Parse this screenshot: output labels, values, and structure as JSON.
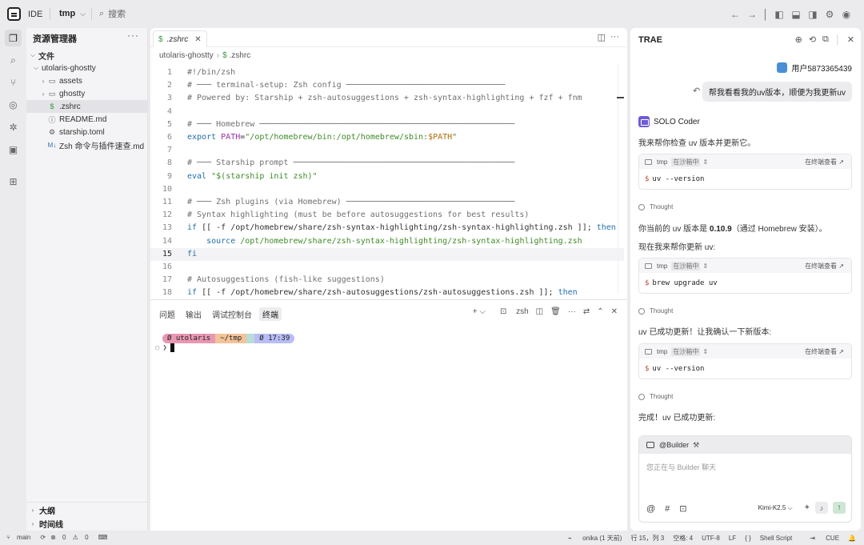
{
  "topbar": {
    "ide_label": "IDE",
    "project": "tmp",
    "search_placeholder": "搜索"
  },
  "explorer": {
    "title": "资源管理器",
    "section": "文件",
    "root": "utolaris-ghostty",
    "items": [
      {
        "name": "assets",
        "type": "folder"
      },
      {
        "name": "ghostty",
        "type": "folder"
      },
      {
        "name": ".zshrc",
        "type": "shell"
      },
      {
        "name": "README.md",
        "type": "info"
      },
      {
        "name": "starship.toml",
        "type": "gear"
      },
      {
        "name": "Zsh 命令与插件速查.md",
        "type": "markdown"
      }
    ],
    "outline": "大纲",
    "timeline": "时间线"
  },
  "editor": {
    "tab_label": ".zshrc",
    "breadcrumb_root": "utolaris-ghostty",
    "breadcrumb_file": ".zshrc",
    "current_line": 15,
    "lines": [
      "#!/bin/zsh",
      "# ─── terminal-setup: Zsh config ─────────────────────────────────",
      "# Powered by: Starship + zsh-autosuggestions + zsh-syntax-highlighting + fzf + fnm",
      "",
      "# ─── Homebrew ─────────────────────────────────────────────────────",
      "export PATH=\"/opt/homebrew/bin:/opt/homebrew/sbin:$PATH\"",
      "",
      "# ─── Starship prompt ──────────────────────────────────────────────",
      "eval \"$(starship init zsh)\"",
      "",
      "# ─── Zsh plugins (via Homebrew) ───────────────────────────────────",
      "# Syntax highlighting (must be before autosuggestions for best results)",
      "if [[ -f /opt/homebrew/share/zsh-syntax-highlighting/zsh-syntax-highlighting.zsh ]]; then",
      "    source /opt/homebrew/share/zsh-syntax-highlighting/zsh-syntax-highlighting.zsh",
      "fi",
      "",
      "# Autosuggestions (fish-like suggestions)",
      "if [[ -f /opt/homebrew/share/zsh-autosuggestions/zsh-autosuggestions.zsh ]]; then"
    ]
  },
  "panel": {
    "tabs": [
      "问题",
      "输出",
      "调试控制台",
      "终端"
    ],
    "active_tab": "终端",
    "shell_label": "zsh",
    "prompt_user": "utolaris",
    "prompt_path": "~/tmp",
    "prompt_time": "17:39",
    "prompt_symbol": "❯"
  },
  "chat": {
    "title": "TRAE",
    "user_name": "用户5873365439",
    "user_message": "帮我看看我的uv版本，顺便为我更新uv",
    "agent_name": "SOLO Coder",
    "msg1": "我来帮你检查 uv 版本并更新它。",
    "thought_label": "Thought",
    "msg2_pre": "你当前的 uv 版本是 ",
    "msg2_ver": "0.10.9",
    "msg2_post": "（通过 Homebrew 安装）。",
    "msg3": "现在我来帮你更新 uv:",
    "msg4": "uv 已成功更新！让我确认一下新版本:",
    "msg5": "完成！uv 已成功更新:",
    "terminal_blocks": [
      {
        "cwd": "tmp",
        "sandbox": "在沙箱中",
        "open_label": "在终端查看",
        "command": "uv --version"
      },
      {
        "cwd": "tmp",
        "sandbox": "在沙箱中",
        "open_label": "在终端查看",
        "command": "brew upgrade uv"
      },
      {
        "cwd": "tmp",
        "sandbox": "在沙箱中",
        "open_label": "在终端查看",
        "command": "uv --version"
      }
    ],
    "composer": {
      "agent": "@Builder",
      "placeholder": "您正在与 Builder 聊天",
      "model": "Kimi-K2.5"
    }
  },
  "status": {
    "branch": "main",
    "errors": "0",
    "warnings": "0",
    "blame": "onika (1 天前)",
    "position": "行 15，列 3",
    "spaces": "空格: 4",
    "encoding": "UTF-8",
    "eol": "LF",
    "braces": "{ }",
    "language": "Shell Script",
    "extra": "CUE"
  },
  "colors": {
    "accent_green": "#3a9a3a",
    "agent_purple": "#6f5bd6",
    "prompt_pink": "#e997b3",
    "prompt_orange": "#f3c399",
    "prompt_lavender": "#b9bdf5"
  }
}
